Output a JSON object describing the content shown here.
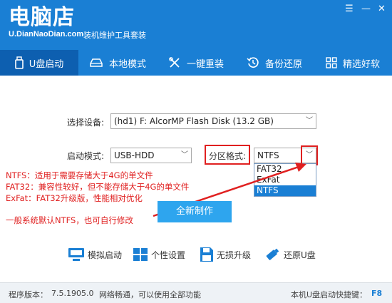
{
  "header": {
    "logo": "电脑店",
    "logo_sub": "U.DianNaoDian.com",
    "tagline": "装机维护工具套装",
    "window_controls": {
      "menu": "☰",
      "minimize": "—",
      "close": "✕"
    }
  },
  "nav": {
    "tabs": [
      {
        "label": "U盘启动",
        "icon": "usb-drive-icon",
        "active": true
      },
      {
        "label": "本地模式",
        "icon": "hard-disk-icon",
        "active": false
      },
      {
        "label": "一键重装",
        "icon": "tools-icon",
        "active": false
      },
      {
        "label": "备份还原",
        "icon": "restore-icon",
        "active": false
      },
      {
        "label": "精选好软",
        "icon": "apps-grid-icon",
        "active": false
      }
    ]
  },
  "form": {
    "device_label": "选择设备:",
    "device_value": "(hd1) F: AlcorMP Flash Disk (13.2 GB)",
    "mode_label": "启动模式:",
    "mode_value": "USB-HDD",
    "partition_label": "分区格式:",
    "partition_value": "NTFS",
    "partition_options": [
      "FAT32",
      "ExFat",
      "NTFS"
    ],
    "partition_selected": "NTFS",
    "start_button": "全新制作"
  },
  "annotations": {
    "lines": [
      "NTFS：适用于需要存储大于4G的单文件",
      "FAT32：兼容性较好，但不能存储大于4G的单文件",
      "ExFat：FAT32升级版，性能相对优化"
    ],
    "tip": "一般系统默认NTFS，也可自行修改"
  },
  "tools": [
    {
      "label": "模拟启动",
      "icon": "monitor-icon"
    },
    {
      "label": "个性设置",
      "icon": "settings-grid-icon"
    },
    {
      "label": "无损升级",
      "icon": "save-icon"
    },
    {
      "label": "还原U盘",
      "icon": "usb-stick-icon"
    }
  ],
  "status": {
    "version_label": "程序版本：",
    "version": "7.5.1905.0",
    "network": "网络畅通，可以使用全部功能",
    "hotkey_label": "本机U盘启动快捷键：",
    "hotkey": "F8"
  },
  "colors": {
    "accent": "#1a7fd4",
    "highlight": "#e02020",
    "button": "#2ea5ee"
  }
}
